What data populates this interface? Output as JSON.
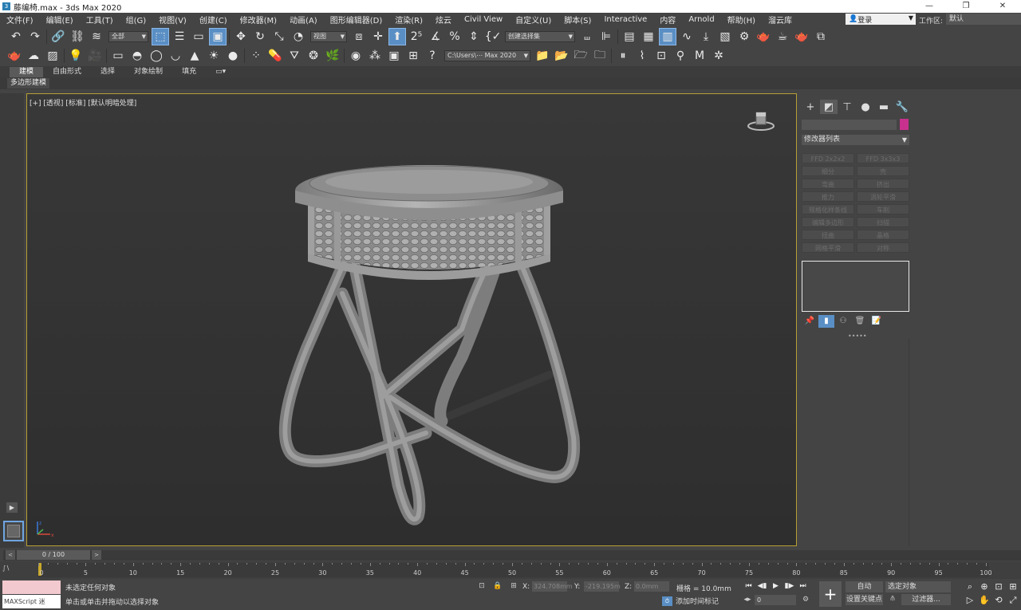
{
  "window": {
    "title": "藤编椅.max - 3ds Max 2020",
    "minimize": "—",
    "maximize": "❐",
    "close": "✕"
  },
  "menu": [
    "文件(F)",
    "编辑(E)",
    "工具(T)",
    "组(G)",
    "视图(V)",
    "创建(C)",
    "修改器(M)",
    "动画(A)",
    "图形编辑器(D)",
    "渲染(R)",
    "炫云",
    "Civil View",
    "自定义(U)",
    "脚本(S)",
    "Interactive",
    "内容",
    "Arnold",
    "帮助(H)",
    "溜云库"
  ],
  "login": {
    "label": "登录"
  },
  "workspace": {
    "label": "工作区:",
    "value": "默认"
  },
  "toolbar": {
    "selection_filter": "全部",
    "ref_coord": "视图",
    "named_selection": "创建选择集",
    "project_path": "C:\\Users\\⋯ Max 2020"
  },
  "ribbon": {
    "tabs": [
      "建模",
      "自由形式",
      "选择",
      "对象绘制",
      "填充"
    ],
    "active_tab": "建模",
    "sub_label": "多边形建模"
  },
  "viewport": {
    "label": "[+] [透视] [标准] [默认明暗处理]"
  },
  "command_panel": {
    "modifier_list_label": "修改器列表",
    "swatch_color": "#c8318d",
    "modifier_buttons": [
      "FFD 2x2x2",
      "FFD 3x3x3",
      "细分",
      "壳",
      "弯曲",
      "挤出",
      "推力",
      "涡轮平滑",
      "规格化样条线",
      "车削",
      "编辑多边形",
      "扫描",
      "扭曲",
      "晶格",
      "网格平滑",
      "对称"
    ]
  },
  "time_slider": {
    "value": "0 / 100"
  },
  "timeline": {
    "ticks": [
      0,
      5,
      10,
      15,
      20,
      25,
      30,
      35,
      40,
      45,
      50,
      55,
      60,
      65,
      70,
      75,
      80,
      85,
      90,
      95,
      100
    ]
  },
  "status": {
    "maxscript_label": "MAXScript 迷",
    "line1": "未选定任何对象",
    "line2": "单击或单击并拖动以选择对象",
    "x_label": "X:",
    "x_value": "324.708mm",
    "y_label": "Y:",
    "y_value": "-219.195m",
    "z_label": "Z:",
    "z_value": "0.0mm",
    "grid": "栅格 = 10.0mm",
    "add_time_tag": "添加时间标记",
    "auto_key": "自动",
    "selected_object": "选定对象",
    "set_key": "设置关键点",
    "filters": "过滤器...",
    "frame_value": "0"
  }
}
